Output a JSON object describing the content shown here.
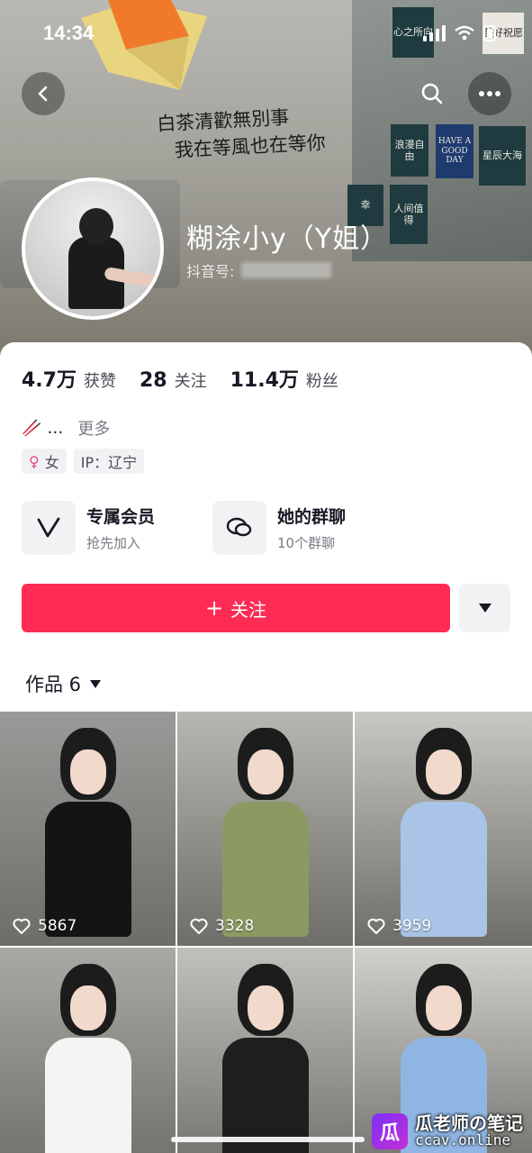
{
  "status_bar": {
    "time": "14:34"
  },
  "banner": {
    "quote_line1": "白茶清歡無別事",
    "quote_line2": "我在等風也在等你",
    "cards": [
      "心之所向",
      "美好祝愿",
      "浪漫自由",
      "HAVE A GOOD DAY",
      "星辰大海",
      "人间值得",
      "幸"
    ]
  },
  "profile": {
    "nickname": "糊涂小y（Y姐）",
    "douyin_id_label": "抖音号:"
  },
  "stats": [
    {
      "value": "4.7万",
      "label": "获赞"
    },
    {
      "value": "28",
      "label": "关注"
    },
    {
      "value": "11.4万",
      "label": "粉丝"
    }
  ],
  "bio": {
    "emoji": "🥢",
    "text": "…",
    "more": "更多"
  },
  "tags": {
    "gender": "女",
    "ip": "IP：辽宁"
  },
  "features": [
    {
      "title": "专属会员",
      "subtitle": "抢先加入",
      "icon": "v-icon"
    },
    {
      "title": "她的群聊",
      "subtitle": "10个群聊",
      "icon": "chat-bubbles-icon"
    }
  ],
  "follow": {
    "label": "关注",
    "plus": "+"
  },
  "works": {
    "label": "作品 6"
  },
  "videos": [
    {
      "likes": "5867",
      "top": "#141414",
      "bg": "#9a9a98"
    },
    {
      "likes": "3328",
      "top": "#8a9a62",
      "bg": "#b8b6b0"
    },
    {
      "likes": "3959",
      "top": "#a9c4e6",
      "bg": "#c9c7c2"
    },
    {
      "likes": "",
      "top": "#f4f4f2",
      "bg": "#a8a8a4"
    },
    {
      "likes": "",
      "top": "#1e1e1e",
      "bg": "#c2c0bb"
    },
    {
      "likes": "",
      "top": "#8fb6e3",
      "bg": "#d2d0cb"
    }
  ],
  "watermark": {
    "line1": "瓜老师の笔记",
    "line2": "ccav.online",
    "logo": "瓜"
  },
  "colors": {
    "accent": "#fe2c55",
    "text": "#161823",
    "muted": "#7a7b84"
  }
}
